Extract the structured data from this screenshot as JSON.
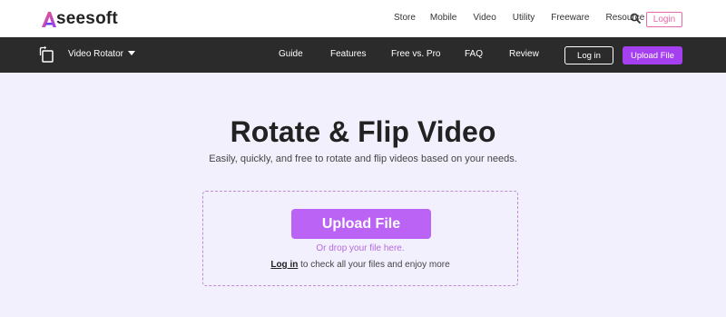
{
  "brand": {
    "name": "seesoft",
    "mark": "A"
  },
  "top_nav": {
    "items": [
      "Store",
      "Mobile",
      "Video",
      "Utility",
      "Freeware",
      "Resource"
    ],
    "login": "Login"
  },
  "toolbar": {
    "tool_name": "Video Rotator",
    "links": [
      "Guide",
      "Features",
      "Free vs. Pro",
      "FAQ",
      "Review"
    ],
    "login": "Log in",
    "upload": "Upload File"
  },
  "hero": {
    "title": "Rotate & Flip Video",
    "subtitle": "Easily, quickly, and free to rotate and flip videos based on your needs."
  },
  "dropzone": {
    "button": "Upload File",
    "drop_text": "Or drop your file here.",
    "login_link": "Log in",
    "login_text": " to check all your files and enjoy more"
  },
  "colors": {
    "accent": "#a540f0",
    "upload_button": "#bb63f4",
    "login_outline": "#e46aa8",
    "toolbar_bg": "#2b2b2b",
    "main_bg": "#f3f0fe"
  }
}
